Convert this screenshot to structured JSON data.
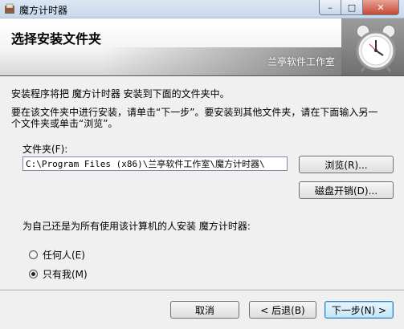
{
  "window": {
    "title": "魔方计时器",
    "minimize_glyph": "–",
    "maximize_glyph": "□",
    "close_glyph": "✕"
  },
  "banner": {
    "title": "选择安装文件夹",
    "subtitle": "兰亭软件工作室"
  },
  "body": {
    "line1": "安装程序将把 魔方计时器 安装到下面的文件夹中。",
    "line2": "要在该文件夹中进行安装，请单击“下一步”。要安装到其他文件夹，请在下面输入另一",
    "line3": "个文件夹或单击“浏览”。",
    "folder_label": "文件夹(F):",
    "folder_path": "C:\\Program Files (x86)\\兰亭软件工作室\\魔方计时器\\",
    "browse_button": "浏览(R)...",
    "disk_cost_button": "磁盘开销(D)...",
    "install_for_label": "为自己还是为所有使用该计算机的人安装 魔方计时器:",
    "options": [
      {
        "label": "任何人(E)",
        "checked": false
      },
      {
        "label": "只有我(M)",
        "checked": true
      }
    ]
  },
  "footer": {
    "cancel_button": "取消",
    "back_button": "< 后退(B)",
    "next_button": "下一步(N) >"
  }
}
